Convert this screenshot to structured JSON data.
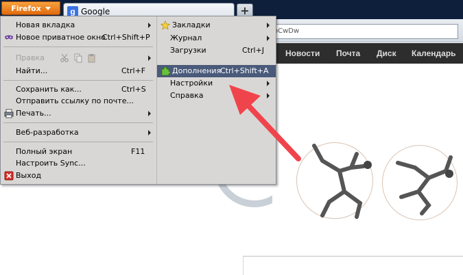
{
  "titlebar": {
    "firefox_label": "Firefox"
  },
  "tab": {
    "title": "Google",
    "favicon_letter": "g"
  },
  "newtab_label": "+",
  "urlbar": {
    "value_visible": "oCwDw"
  },
  "google_nav": [
    "Новости",
    "Почта",
    "Диск",
    "Календарь"
  ],
  "main_menu": {
    "left": [
      {
        "label": "Новая вкладка",
        "shortcut": "",
        "submenu": true
      },
      {
        "label": "Новое приватное окно",
        "shortcut": "Ctrl+Shift+P",
        "submenu": false,
        "icon": "private-mask-icon"
      },
      {
        "label": "Правка",
        "shortcut": "",
        "submenu": true,
        "disabled": true
      },
      {
        "label": "Найти...",
        "shortcut": "Ctrl+F",
        "submenu": false
      },
      {
        "label": "Сохранить как...",
        "shortcut": "Ctrl+S",
        "submenu": false
      },
      {
        "label": "Отправить ссылку по почте...",
        "shortcut": "",
        "submenu": false
      },
      {
        "label": "Печать...",
        "shortcut": "",
        "submenu": true,
        "icon": "printer-icon"
      },
      {
        "label": "Веб-разработка",
        "shortcut": "",
        "submenu": true
      },
      {
        "label": "Полный экран",
        "shortcut": "F11",
        "submenu": false
      },
      {
        "label": "Настроить Sync...",
        "shortcut": "",
        "submenu": false
      },
      {
        "label": "Выход",
        "shortcut": "",
        "submenu": false,
        "icon": "exit-icon"
      }
    ],
    "right": [
      {
        "label": "Закладки",
        "shortcut": "",
        "submenu": true,
        "icon": "star-icon"
      },
      {
        "label": "Журнал",
        "shortcut": "",
        "submenu": true
      },
      {
        "label": "Загрузки",
        "shortcut": "Ctrl+J",
        "submenu": false
      },
      {
        "label": "Дополнения",
        "shortcut": "Ctrl+Shift+A",
        "submenu": false,
        "icon": "puzzle-icon",
        "highlighted": true
      },
      {
        "label": "Настройки",
        "shortcut": "",
        "submenu": true
      },
      {
        "label": "Справка",
        "shortcut": "",
        "submenu": true
      }
    ]
  },
  "colors": {
    "firefox_button": "#e8801f",
    "menu_bg": "#d9d7d5",
    "menu_highlight": "#4a5a7a",
    "google_bar": "#2d2d2d",
    "annotation_arrow": "#f0444c"
  }
}
